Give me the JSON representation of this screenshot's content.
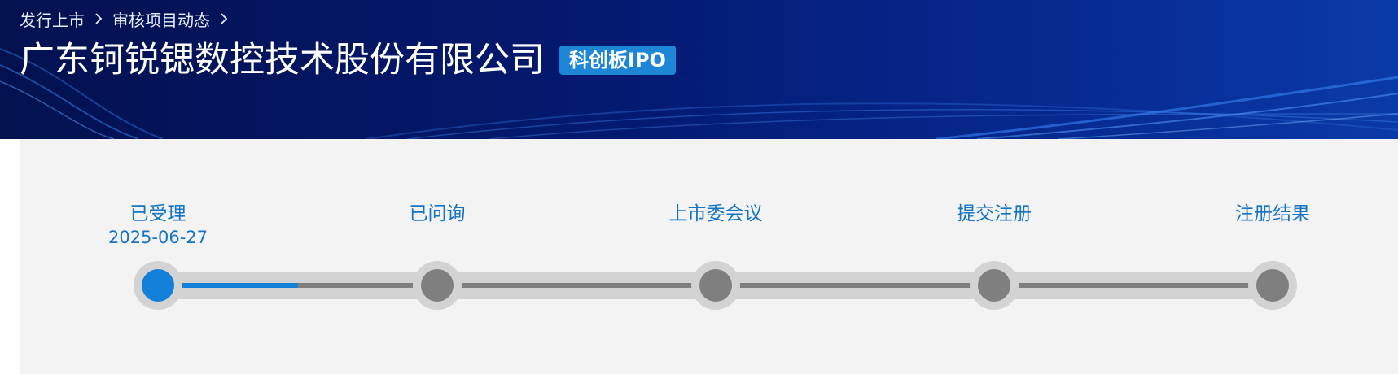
{
  "breadcrumb": {
    "items": [
      "发行上市",
      "审核项目动态"
    ]
  },
  "company": {
    "name": "广东钶锐锶数控技术股份有限公司",
    "board_badge": "科创板IPO"
  },
  "progress": {
    "active_color": "#127fd8",
    "inactive_color": "#7f7f7f",
    "completed_fraction_to_next": 0.5,
    "steps": [
      {
        "label": "已受理",
        "date": "2025-06-27",
        "status": "done"
      },
      {
        "label": "已问询",
        "date": "",
        "status": "pending"
      },
      {
        "label": "上市委会议",
        "date": "",
        "status": "pending"
      },
      {
        "label": "提交注册",
        "date": "",
        "status": "pending"
      },
      {
        "label": "注册结果",
        "date": "",
        "status": "pending"
      }
    ]
  }
}
